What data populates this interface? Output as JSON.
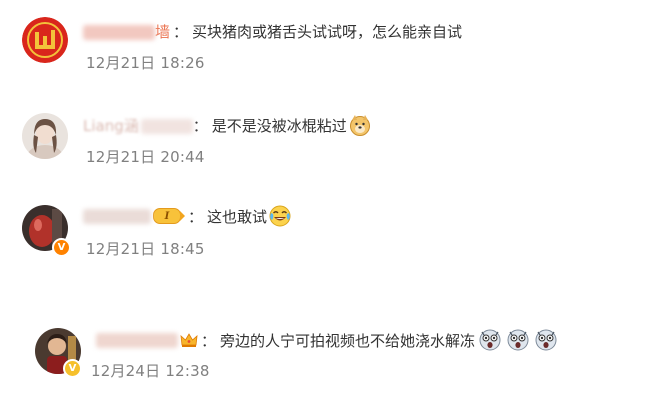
{
  "colors": {
    "username": "#eb7350",
    "timestamp": "#808080",
    "text": "#333333",
    "verified_badge": "#ff8200"
  },
  "comments": [
    {
      "username_visible": "墙",
      "separator": "：",
      "text": "买块猪肉或猪舌头试试呀，怎么能亲自试",
      "time": "12月21日 18:26",
      "avatar_icon": "red-logo-avatar"
    },
    {
      "username_visible": "Liang涵",
      "separator": "：",
      "text": "是不是没被冰棍粘过",
      "emojis": [
        "doge-emoji"
      ],
      "time": "12月21日 20:44",
      "avatar_icon": "portrait-avatar"
    },
    {
      "username_visible": "",
      "level_badge": "I",
      "separator": "：",
      "text": "这也敢试",
      "emojis": [
        "laugh-cry-emoji"
      ],
      "time": "12月21日 18:45",
      "avatar_icon": "red-object-avatar",
      "verified": true
    },
    {
      "username_visible": "",
      "separator": "：",
      "text": "旁边的人宁可拍视频也不给她浇水解冻",
      "emojis": [
        "shocked-emoji",
        "shocked-emoji",
        "shocked-emoji"
      ],
      "time": "12月24日 12:38",
      "avatar_icon": "figurine-avatar",
      "verified": true,
      "crown_badge": "crown-icon"
    }
  ]
}
